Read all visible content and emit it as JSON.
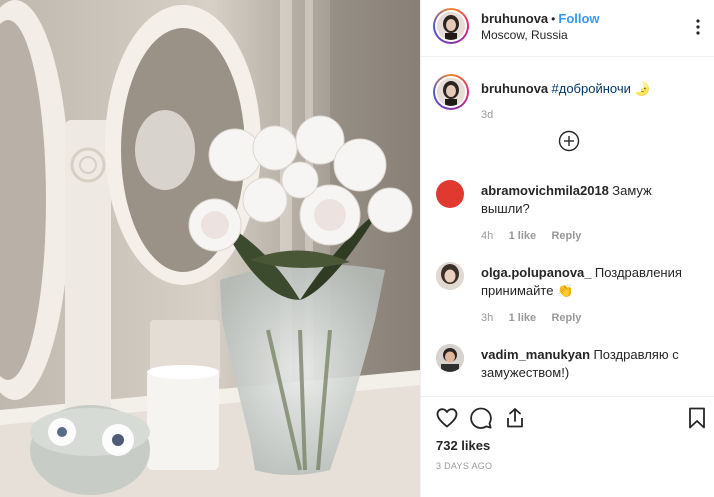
{
  "header": {
    "username": "bruhunova",
    "separator": "•",
    "follow_label": "Follow",
    "location": "Moscow, Russia"
  },
  "caption": {
    "username": "bruhunova",
    "text": "#добройночи",
    "emoji": "🌛",
    "time": "3d"
  },
  "comments": [
    {
      "username": "abramovichmila2018",
      "text_line1": "Замуж",
      "text_line2": "вышли?",
      "time": "4h",
      "likes": "1 like",
      "reply": "Reply",
      "avatar_color": "#e0392f"
    },
    {
      "username": "olga.polupanova_",
      "text_line1": "Поздравления",
      "text_line2": "принимайте 👏",
      "time": "3h",
      "likes": "1 like",
      "reply": "Reply",
      "avatar_color": "#5a5049"
    },
    {
      "username": "vadim_manukyan",
      "text_line1": "Поздравляю с",
      "text_line2": "замужеством!)",
      "avatar_color": "#2f2f2f"
    }
  ],
  "actions": {
    "like_icon": "heart-icon",
    "comment_icon": "comment-icon",
    "share_icon": "share-icon",
    "save_icon": "bookmark-icon"
  },
  "likes_count": "732 likes",
  "date": "3 DAYS AGO",
  "load_more_icon": "plus-circle-icon",
  "colors": {
    "follow_blue": "#3897f0",
    "hashtag_blue": "#00376b",
    "muted": "#999999",
    "divider": "#efefef"
  }
}
